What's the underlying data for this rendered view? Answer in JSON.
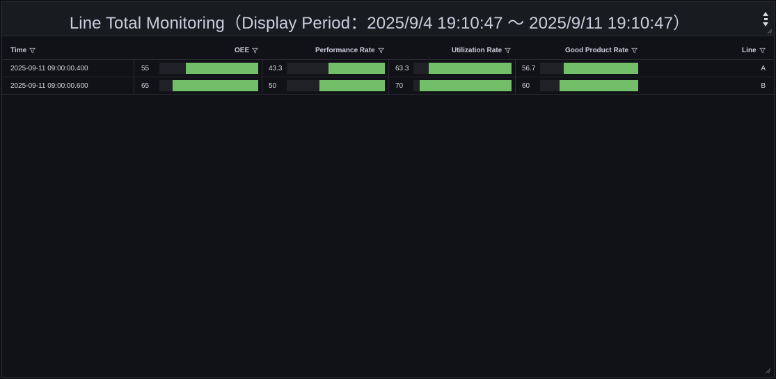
{
  "panel": {
    "title": "Line Total Monitoring（Display Period：2025/9/4 19:10:47 ～ 2025/9/11 19:10:47）"
  },
  "table": {
    "columns": [
      {
        "key": "time",
        "label": "Time"
      },
      {
        "key": "oee",
        "label": "OEE"
      },
      {
        "key": "performance",
        "label": "Performance Rate"
      },
      {
        "key": "utilization",
        "label": "Utilization Rate"
      },
      {
        "key": "good",
        "label": "Good Product Rate"
      },
      {
        "key": "line",
        "label": "Line"
      }
    ],
    "rows": [
      {
        "time": "2025-09-11 09:00:00.400",
        "oee": "55",
        "performance": "43.3",
        "utilization": "63.3",
        "good": "56.7",
        "line": "A"
      },
      {
        "time": "2025-09-11 09:00:00.600",
        "oee": "65",
        "performance": "50",
        "utilization": "70",
        "good": "60",
        "line": "B"
      }
    ]
  },
  "colors": {
    "bar_fill": "#73bf69",
    "bar_track": "#1f2127",
    "background": "#111217"
  },
  "icons": {
    "filter": "filter-icon",
    "scroll": "scroll-arrows-icon",
    "resize": "resize-handle-icon"
  }
}
